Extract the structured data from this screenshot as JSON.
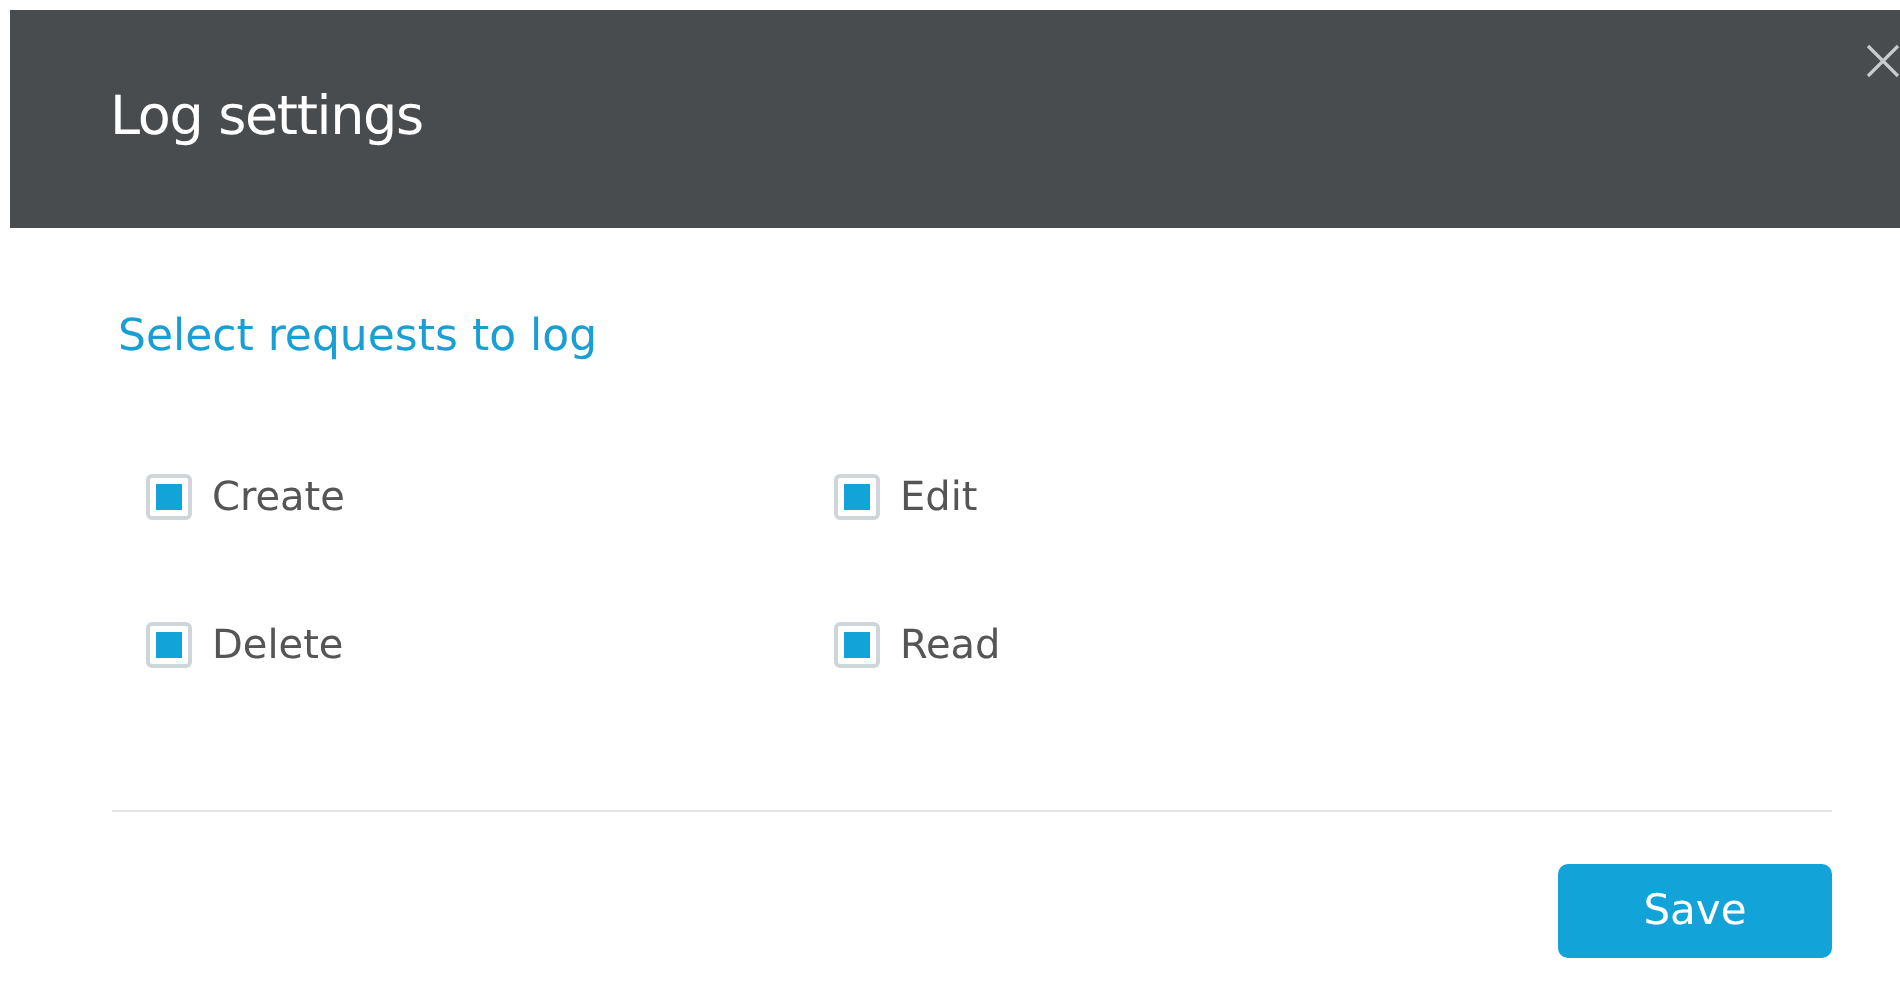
{
  "dialog": {
    "title": "Log settings"
  },
  "section": {
    "heading": "Select requests to log"
  },
  "options": [
    {
      "label": "Create",
      "checked": true
    },
    {
      "label": "Edit",
      "checked": true
    },
    {
      "label": "Delete",
      "checked": true
    },
    {
      "label": "Read",
      "checked": true
    }
  ],
  "buttons": [
    {
      "label": "Save"
    }
  ]
}
